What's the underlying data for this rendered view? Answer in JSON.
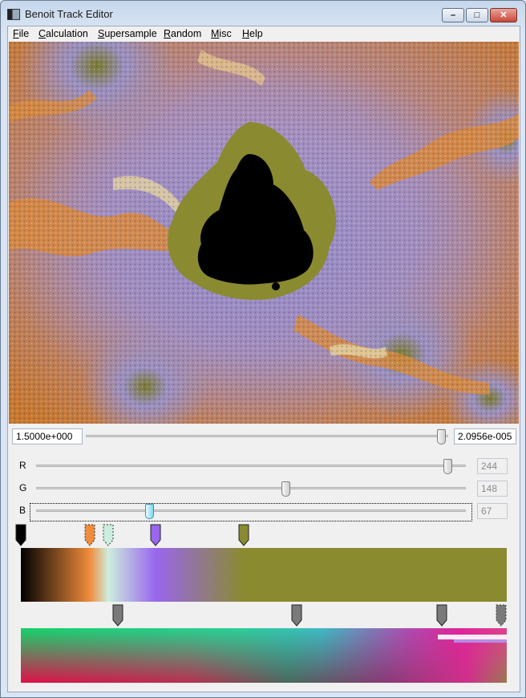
{
  "window": {
    "title": "Benoit Track Editor"
  },
  "menu": [
    {
      "label": "File",
      "mn": "F",
      "rest": "ile"
    },
    {
      "label": "Calculation",
      "mn": "C",
      "rest": "alculation"
    },
    {
      "label": "Supersample",
      "mn": "S",
      "rest": "upersample"
    },
    {
      "label": "Random",
      "mn": "R",
      "rest": "andom"
    },
    {
      "label": "Misc",
      "mn": "M",
      "rest": "isc"
    },
    {
      "label": "Help",
      "mn": "H",
      "rest": "elp"
    }
  ],
  "zoom": {
    "left_value": "1.5000e+000",
    "right_value": "2.0956e-005",
    "slider_position": 0.98
  },
  "rgb": {
    "r": {
      "label": "R",
      "value": "244",
      "level": 0.957
    },
    "g": {
      "label": "G",
      "value": "148",
      "level": 0.58
    },
    "b": {
      "label": "B",
      "value": "67",
      "level": 0.263
    }
  },
  "palette": {
    "stops": [
      {
        "color": "#000000",
        "position": 0.0,
        "selected": false
      },
      {
        "color": "#f08c3c",
        "position": 0.142,
        "selected": false
      },
      {
        "color": "#cceedd",
        "position": 0.18,
        "selected": false
      },
      {
        "color": "#9966ee",
        "position": 0.277,
        "selected": false
      },
      {
        "color": "#8a8a30",
        "position": 0.458,
        "selected": true
      }
    ]
  },
  "track": {
    "keyframes": [
      0.2,
      0.567,
      0.867,
      1.0
    ]
  },
  "colors": {
    "window_bg": "#f0f0f0",
    "fractal_base": "#c77a34",
    "fractal_lace": "#9a88c8",
    "set_color": "#000000"
  }
}
